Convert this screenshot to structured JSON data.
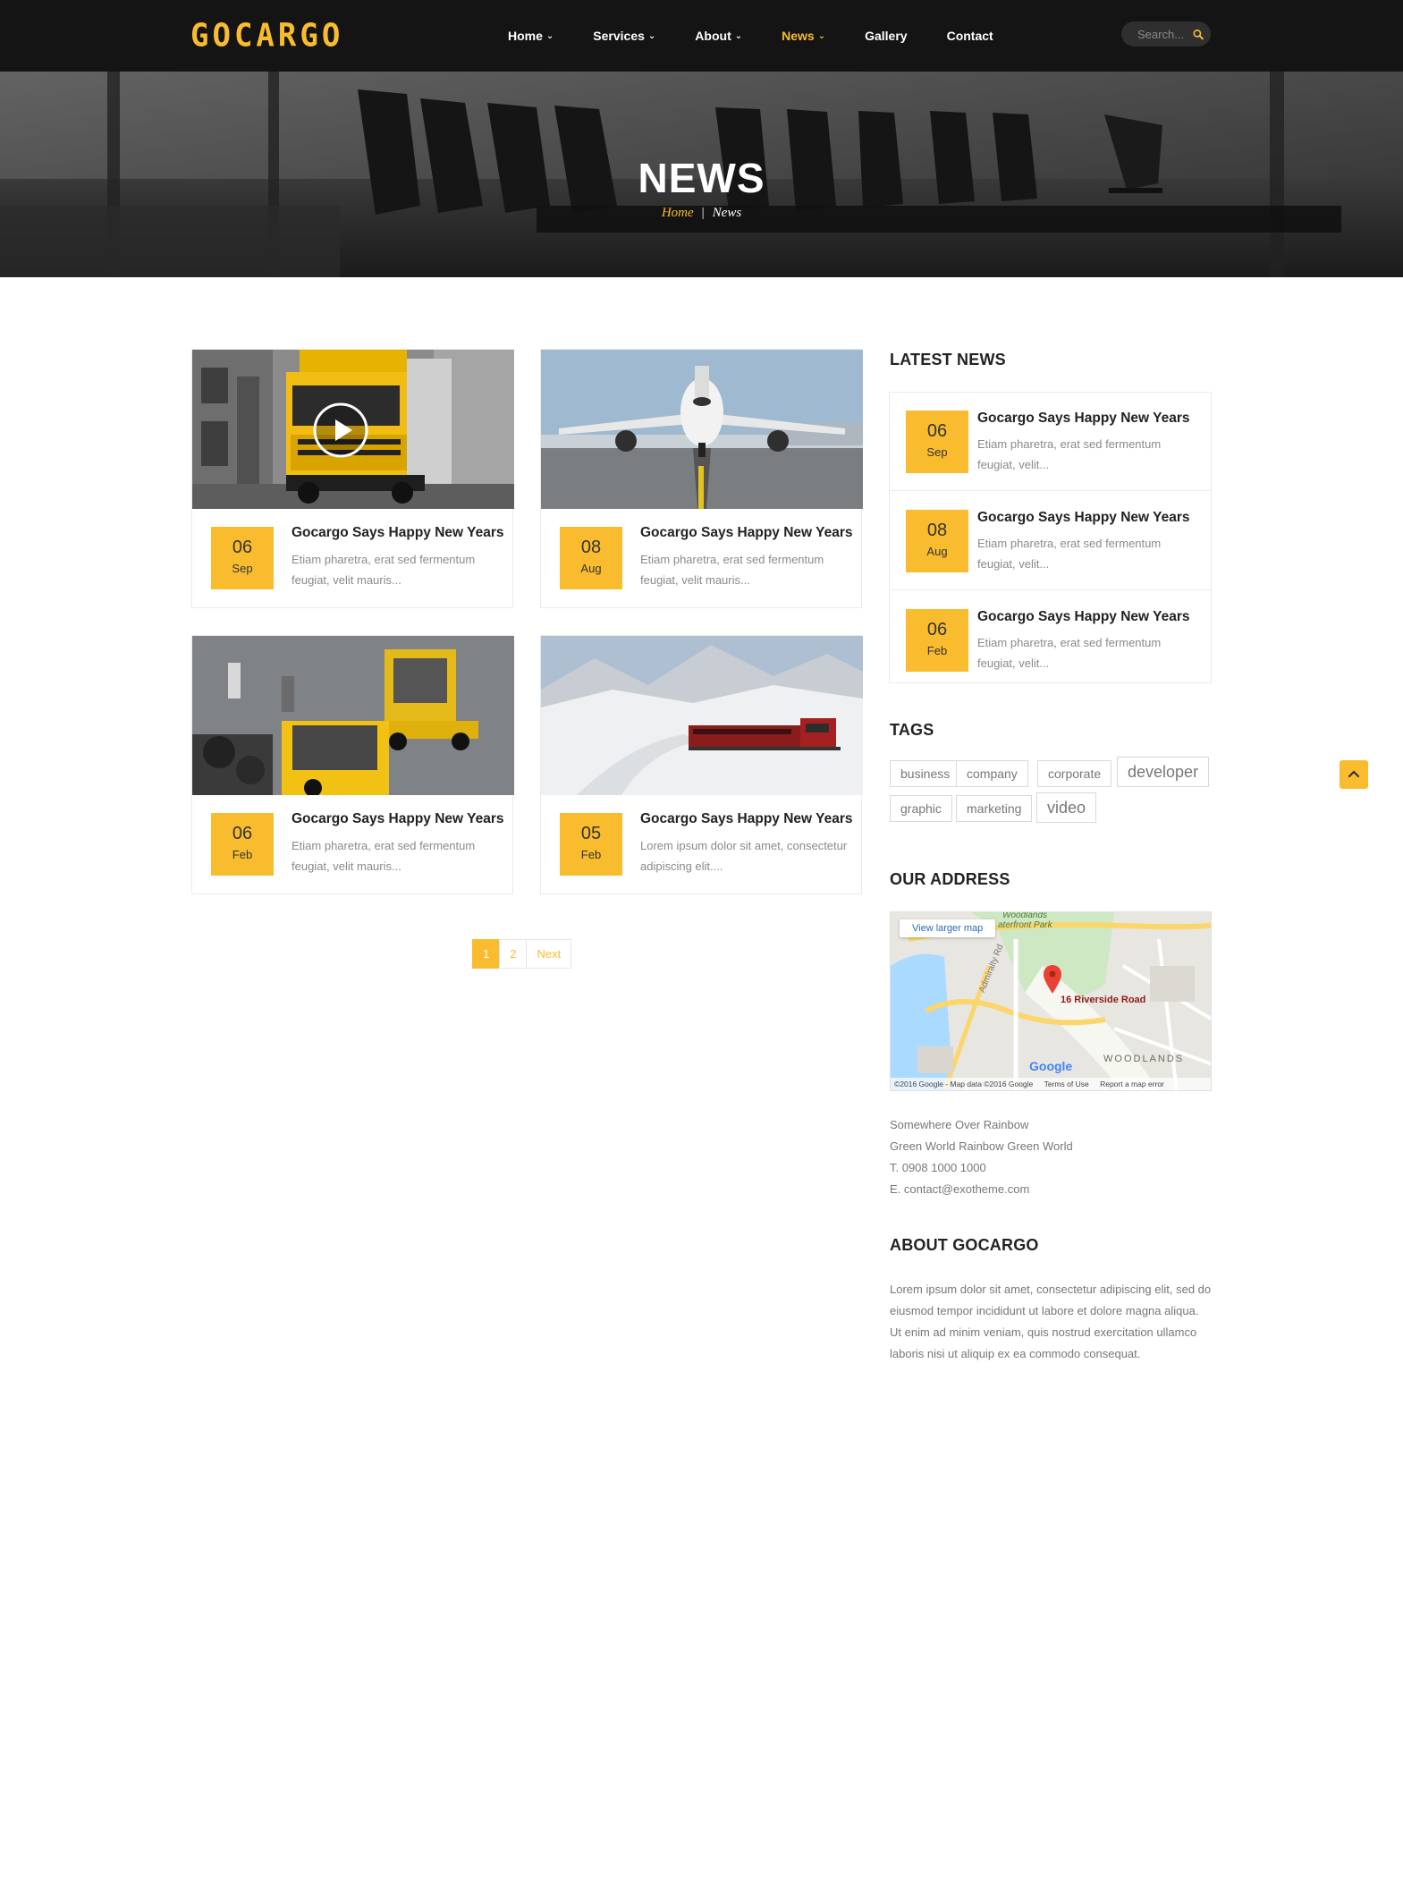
{
  "brand": {
    "logo": "GOCARGO",
    "accent_color": "#f9bc2e"
  },
  "nav": [
    {
      "label": "Home",
      "dropdown": true,
      "active": false
    },
    {
      "label": "Services",
      "dropdown": true,
      "active": false
    },
    {
      "label": "About",
      "dropdown": true,
      "active": false
    },
    {
      "label": "News",
      "dropdown": true,
      "active": true
    },
    {
      "label": "Gallery",
      "dropdown": false,
      "active": false
    },
    {
      "label": "Contact",
      "dropdown": false,
      "active": false
    }
  ],
  "search": {
    "placeholder": "Search..."
  },
  "hero": {
    "title": "NEWS",
    "breadcrumb": {
      "home": "Home",
      "separator": "|",
      "current": "News"
    }
  },
  "posts": [
    {
      "day": "06",
      "month": "Sep",
      "title": "Gocargo Says Happy New Years",
      "excerpt": "Etiam pharetra, erat sed fermentum feugiat, velit mauris...",
      "image": "truck-video"
    },
    {
      "day": "08",
      "month": "Aug",
      "title": "Gocargo Says Happy New Years",
      "excerpt": "Etiam pharetra, erat sed fermentum feugiat, velit mauris...",
      "image": "airplane"
    },
    {
      "day": "06",
      "month": "Feb",
      "title": "Gocargo Says Happy New Years",
      "excerpt": "Etiam pharetra, erat sed fermentum feugiat, velit mauris...",
      "image": "forklifts"
    },
    {
      "day": "05",
      "month": "Feb",
      "title": "Gocargo Says Happy New Years",
      "excerpt": "Lorem ipsum dolor sit amet, consectetur adipiscing elit....",
      "image": "snow-train"
    }
  ],
  "pagination": {
    "pages": [
      "1",
      "2"
    ],
    "current": "1",
    "next": "Next"
  },
  "sidebar": {
    "latest_news_heading": "LATEST NEWS",
    "latest_news": [
      {
        "day": "06",
        "month": "Sep",
        "title": "Gocargo Says Happy New Years",
        "excerpt": "Etiam pharetra, erat sed fermentum feugiat, velit..."
      },
      {
        "day": "08",
        "month": "Aug",
        "title": "Gocargo Says Happy New Years",
        "excerpt": "Etiam pharetra, erat sed fermentum feugiat, velit..."
      },
      {
        "day": "06",
        "month": "Feb",
        "title": "Gocargo Says Happy New Years",
        "excerpt": "Etiam pharetra, erat sed fermentum feugiat, velit..."
      }
    ],
    "tags_heading": "TAGS",
    "tags": [
      "business",
      "company",
      "corporate",
      "developer",
      "graphic",
      "marketing",
      "video"
    ],
    "address_heading": "OUR ADDRESS",
    "map": {
      "view_larger": "View larger map",
      "place_label": "16 Riverside Road",
      "area_label": "WOODLANDS",
      "park_label_1": "Woodlands",
      "park_label_2": "aterfront Park",
      "street_label": "Admiralty Rd",
      "provider": "Google",
      "copyright": "©2016 Google - Map data ©2016 Google",
      "terms": "Terms of Use",
      "report": "Report a map error"
    },
    "address_lines": [
      "Somewhere Over Rainbow",
      "Green World Rainbow Green World",
      "T. 0908 1000 1000",
      "E. contact@exotheme.com"
    ],
    "about_heading": "ABOUT GOCARGO",
    "about_text": "Lorem ipsum dolor sit amet, consectetur adipiscing elit, sed do eiusmod tempor incididunt ut labore et dolore magna aliqua. Ut enim ad minim veniam, quis nostrud exercitation ullamco laboris nisi ut aliquip ex ea commodo consequat."
  },
  "icons": {
    "search": "search-icon",
    "play": "play-icon",
    "back_to_top": "chevron-up-icon",
    "map_pin": "map-pin-icon"
  }
}
